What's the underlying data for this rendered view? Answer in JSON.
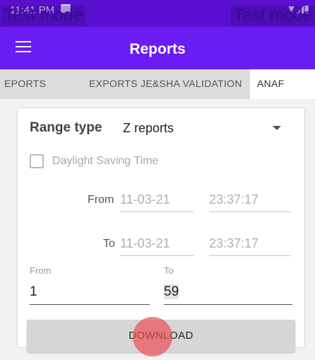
{
  "status_bar": {
    "time": "11:41 PM",
    "icons": "▼◢▮"
  },
  "watermark": {
    "left": "Test mode",
    "right": "Test mode"
  },
  "app_bar": {
    "title": "Reports"
  },
  "tabs": [
    {
      "label": "EPORTS"
    },
    {
      "label": "EXPORTS JE&SHA VALIDATION"
    },
    {
      "label": "ANAF"
    }
  ],
  "form": {
    "range_type_label": "Range type",
    "range_type_value": "Z reports",
    "dst_label": "Daylight Saving Time",
    "from_label": "From",
    "to_label": "To",
    "from_date": "11-03-21",
    "from_time": "23:37:17",
    "to_date": "11-03-21",
    "to_time": "23:37:17",
    "number_from_label": "From",
    "number_to_label": "To",
    "number_from_value": "1",
    "number_to_value": "59",
    "download_label": "DOWNLOAD"
  },
  "colors": {
    "status_bar": "#5a0fd0",
    "app_bar": "#6a1cf5",
    "touch_indicator": "#eb5055"
  }
}
